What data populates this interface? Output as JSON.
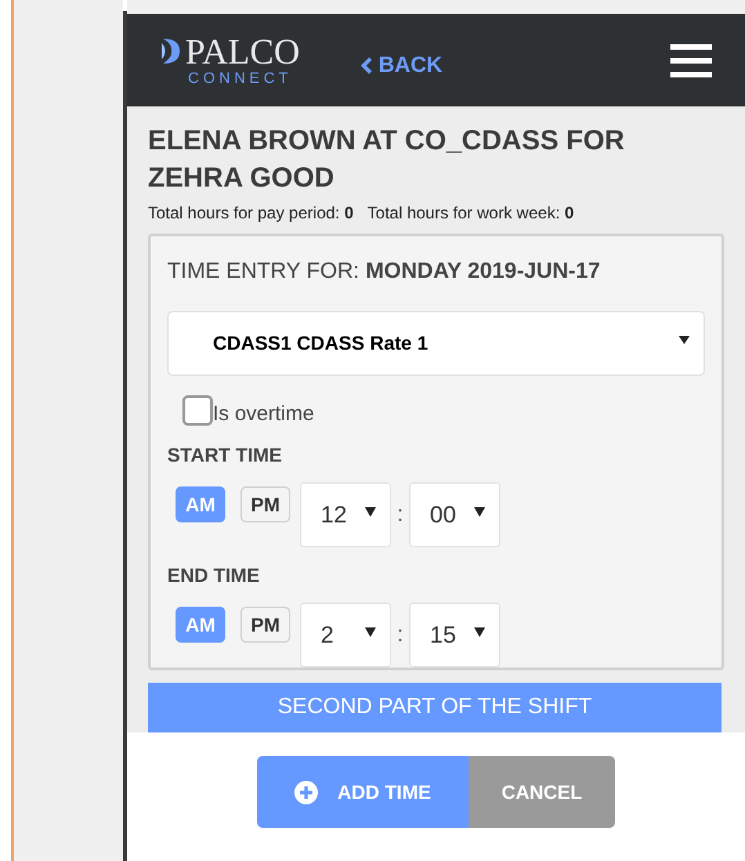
{
  "header": {
    "logo": {
      "name": "PALCO",
      "tagline": "CONNECT"
    },
    "back": "BACK"
  },
  "title": "ELENA BROWN AT CO_CDASS FOR ZEHRA GOOD",
  "totals": [
    {
      "label": "Total hours for pay period:",
      "value": "0"
    },
    {
      "label": "Total hours for work week:",
      "value": "0"
    }
  ],
  "entry": {
    "label": "TIME ENTRY FOR:",
    "date": "MONDAY 2019-JUN-17",
    "rate": "CDASS1 CDASS Rate 1",
    "overtime": {
      "label": "Is overtime",
      "checked": false
    },
    "times": [
      {
        "label": "START TIME",
        "periods": [
          {
            "label": "AM",
            "selected": true
          },
          {
            "label": "PM",
            "selected": false
          }
        ],
        "hour": "12",
        "separator": ":",
        "minute": "00"
      },
      {
        "label": "END TIME",
        "periods": [
          {
            "label": "AM",
            "selected": true
          },
          {
            "label": "PM",
            "selected": false
          }
        ],
        "hour": "2",
        "separator": ":",
        "minute": "15"
      }
    ]
  },
  "shift_bar": "SECOND PART OF THE SHIFT",
  "buttons": [
    {
      "kind": "add",
      "label": "ADD TIME"
    },
    {
      "kind": "cancel",
      "label": "CANCEL"
    }
  ]
}
